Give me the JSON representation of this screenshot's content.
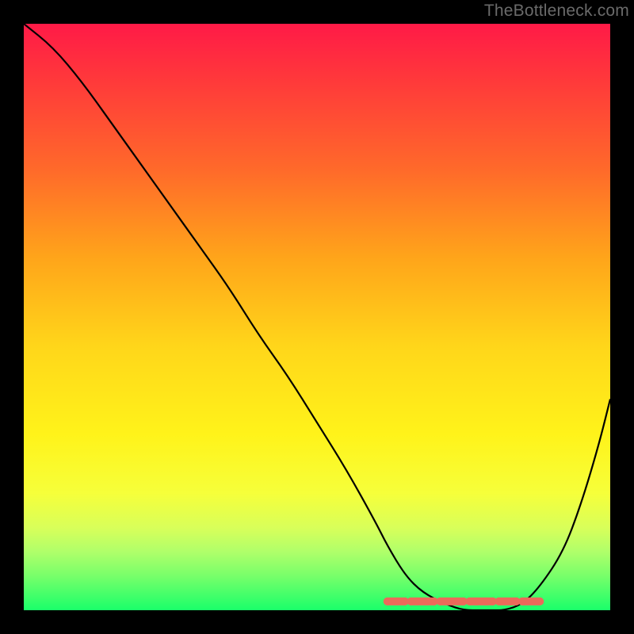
{
  "watermark": "TheBottleneck.com",
  "chart_data": {
    "type": "line",
    "title": "",
    "xlabel": "",
    "ylabel": "",
    "xlim": [
      0,
      100
    ],
    "ylim": [
      0,
      100
    ],
    "series": [
      {
        "name": "bottleneck-curve",
        "x": [
          0,
          5,
          10,
          15,
          20,
          25,
          30,
          35,
          40,
          45,
          50,
          55,
          60,
          62,
          65,
          68,
          72,
          75,
          78,
          80,
          82,
          85,
          88,
          92,
          95,
          98,
          100
        ],
        "values": [
          100,
          96,
          90,
          83,
          76,
          69,
          62,
          55,
          47,
          40,
          32,
          24,
          15,
          11,
          6,
          3,
          1,
          0,
          0,
          0,
          0,
          1,
          4,
          10,
          18,
          28,
          36
        ]
      }
    ],
    "annotation": {
      "name": "optimal-range",
      "color": "#eb6a5a",
      "segments_x": [
        [
          62,
          65
        ],
        [
          66,
          70
        ],
        [
          71,
          75
        ],
        [
          76,
          80
        ],
        [
          81,
          84
        ],
        [
          85,
          88
        ]
      ],
      "y": 1
    },
    "background": "rainbow-gradient-green-bottom-red-top"
  }
}
